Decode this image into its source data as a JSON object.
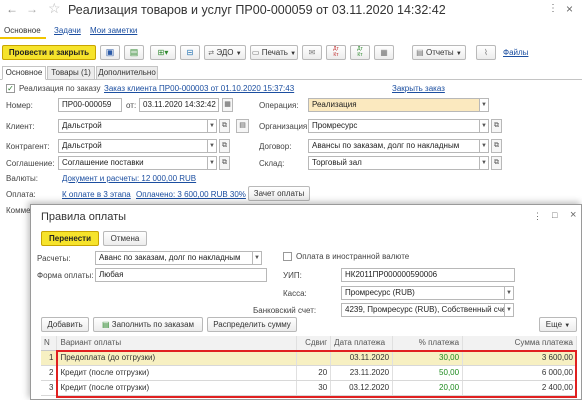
{
  "window": {
    "title": "Реализация товаров и услуг ПР00-000059 от 03.11.2020 14:32:42",
    "menu_icon": "more-dots-icon",
    "close_icon": "close-icon"
  },
  "nav": {
    "main": "Основное",
    "tasks": "Задачи",
    "notes": "Мои заметки"
  },
  "toolbar": {
    "post_close": "Провести и закрыть",
    "edo": "ЭДО",
    "print": "Печать",
    "reports": "Отчеты",
    "files": "Файлы",
    "dt_kt": "Дт\nКт",
    "attach_icon": "paperclip-icon"
  },
  "tabs": [
    "Основное",
    "Товары (1)",
    "Дополнительно"
  ],
  "header": {
    "by_order_checked": true,
    "by_order": "Реализация по заказу",
    "order_link": "Заказ клиента ПР00-000003 от 01.10.2020 15:37:43",
    "close_order": "Закрыть заказ"
  },
  "form": {
    "number_label": "Номер:",
    "number_value": "ПР00-000059",
    "from_label": "от:",
    "date_value": "03.11.2020 14:32:42",
    "client_label": "Клиент:",
    "client_value": "Дальстрой",
    "counterparty_label": "Контрагент:",
    "counterparty_value": "Дальстрой",
    "agreement_label": "Соглашение:",
    "agreement_value": "Соглашение поставки",
    "operation_label": "Операция:",
    "operation_value": "Реализация",
    "org_label": "Организация:",
    "org_value": "Промресурс",
    "contract_label": "Договор:",
    "contract_value": "Авансы по заказам, долг по накладным",
    "warehouse_label": "Склад:",
    "warehouse_value": "Торговый зал",
    "currency_label": "Валюты:",
    "currency_link": "Документ и расчеты: 12 000,00 RUB",
    "payment_label": "Оплата:",
    "payment_stages": "К оплате в 3 этапа",
    "paid_link": "Оплачено: 3 600,00 RUB 30%",
    "offset_button": "Зачет оплаты",
    "comment_label": "Коммен"
  },
  "dialog": {
    "title": "Правила оплаты",
    "transfer": "Перенести",
    "cancel": "Отмена",
    "settlements_label": "Расчеты:",
    "settlements_value": "Аванс по заказам, долг по накладным",
    "foreign_label": "Оплата в иностранной валюте",
    "payment_form_label": "Форма оплаты:",
    "payment_form_value": "Любая",
    "uip_label": "УИП:",
    "uip_value": "НК2011ПР000000590006",
    "cashbox_label": "Касса:",
    "cashbox_value": "Промресурс (RUB)",
    "bank_label": "Банковский счет:",
    "bank_value": "4239, Промресурс (RUB), Собственный счет",
    "add": "Добавить",
    "fill_orders": "Заполнить по заказам",
    "distribute": "Распределить сумму",
    "more": "Еще"
  },
  "table": {
    "columns": [
      "N",
      "Вариант оплаты",
      "Сдвиг",
      "Дата платежа",
      "% платежа",
      "Сумма платежа"
    ],
    "rows": [
      {
        "n": "1",
        "variant": "Предоплата (до отгрузки)",
        "shift": "",
        "date": "03.11.2020",
        "pct": "30,00",
        "sum": "3 600,00"
      },
      {
        "n": "2",
        "variant": "Кредит (после отгрузки)",
        "shift": "20",
        "date": "23.11.2020",
        "pct": "50,00",
        "sum": "6 000,00"
      },
      {
        "n": "3",
        "variant": "Кредит (после отгрузки)",
        "shift": "30",
        "date": "03.12.2020",
        "pct": "20,00",
        "sum": "2 400,00"
      }
    ]
  },
  "colors": {
    "accent_yellow": "#f6e32b",
    "highlight_red": "#e02020",
    "link_blue": "#1b4ea0",
    "pct_green": "#1e8a1e"
  }
}
